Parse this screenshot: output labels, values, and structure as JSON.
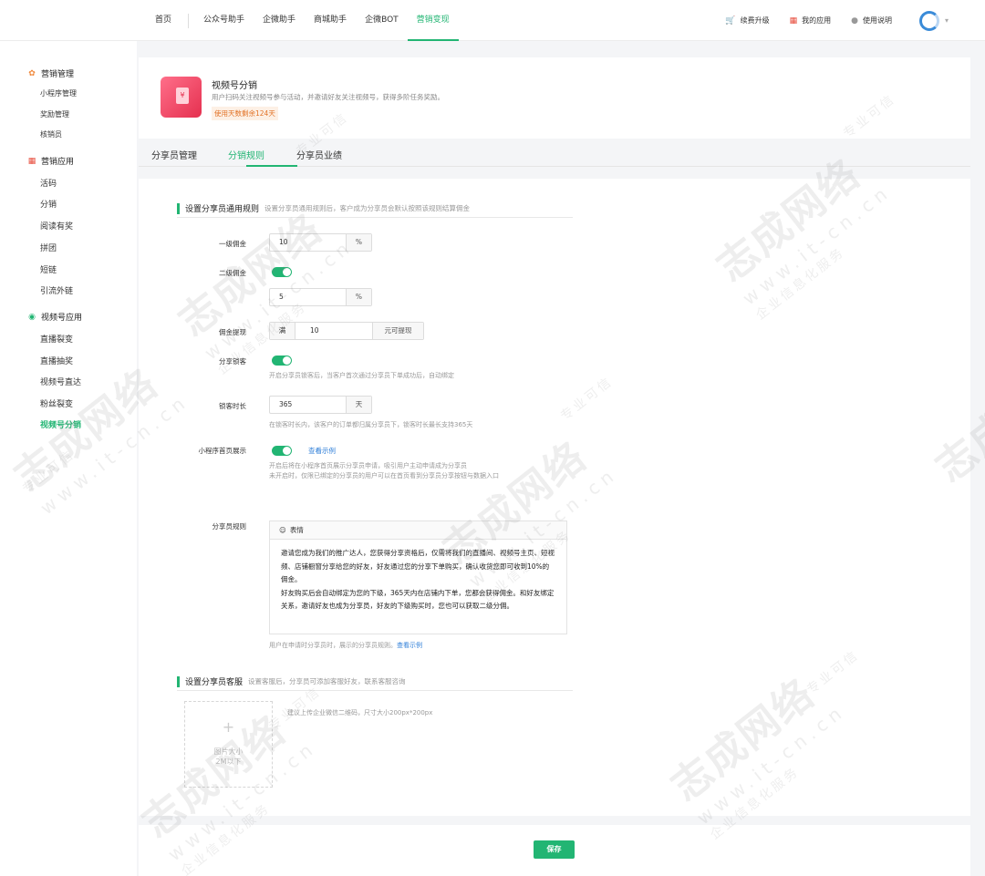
{
  "topnav": {
    "items": [
      "首页",
      "公众号助手",
      "企微助手",
      "商城助手",
      "企微BOT",
      "营销变现"
    ],
    "active_index": 5,
    "right": {
      "renew": "续费升级",
      "my_apps": "我的应用",
      "help": "使用说明"
    }
  },
  "sidebar": {
    "groups": [
      {
        "label": "营销管理",
        "icon": "gear-icon",
        "items": [
          "小程序管理",
          "奖励管理",
          "核销员"
        ]
      },
      {
        "label": "营销应用",
        "icon": "apps-grid-icon",
        "items": [
          "活码",
          "分销",
          "阅读有奖",
          "拼团",
          "短链",
          "引流外链"
        ]
      },
      {
        "label": "视频号应用",
        "icon": "video-channel-icon",
        "items": [
          "直播裂变",
          "直播抽奖",
          "视频号直达",
          "粉丝裂变",
          "视频号分销"
        ]
      }
    ],
    "active_item": "视频号分销"
  },
  "app": {
    "title": "视频号分销",
    "desc": "用户扫码关注视频号参与活动，并邀请好友关注视频号，获得多阶任务奖励。",
    "badge": "使用天数剩余124天"
  },
  "tabs": [
    "分享员管理",
    "分销规则",
    "分享员业绩"
  ],
  "active_tab": 1,
  "rules": {
    "section_title": "设置分享员通用规则",
    "section_hint": "设置分享员通用规则后，客户成为分享员会默认按照该规则结算佣金",
    "level1": {
      "label": "一级佣金",
      "value": "10",
      "suffix": "%"
    },
    "level2": {
      "label": "二级佣金",
      "enabled": true,
      "value": "5",
      "suffix": "%"
    },
    "withdraw": {
      "label": "佣金提现",
      "prefix": "满",
      "value": "10",
      "suffix": "元可提现"
    },
    "lock": {
      "label": "分享锁客",
      "enabled": true,
      "help": "开启分享员锁客后，当客户首次通过分享员下单成功后，自动绑定"
    },
    "lock_duration": {
      "label": "锁客时长",
      "value": "365",
      "suffix": "天",
      "help": "在锁客时长内，该客户的订单都归属分享员下，锁客时长最长支持365天"
    },
    "homepage": {
      "label": "小程序首页展示",
      "enabled": true,
      "link": "查看示例",
      "help1": "开启后将在小程序首页展示分享员申请，吸引用户主动申请成为分享员",
      "help2": "未开启时，仅限已绑定的分享员的用户可以在首页看到分享员分享按钮与数据入口"
    },
    "rule_text": {
      "label": "分享员规则",
      "toolbar": "表情",
      "p1": "邀请您成为我们的推广达人，您获得分享资格后，仅需将我们的直播间、视频号主页、短视频、店铺橱窗分享给您的好友，好友通过您的分享下单购买，确认收货您即可收到10%的佣金。",
      "p2": "好友购买后会自动绑定为您的下级，365天内在店铺内下单，您都会获得佣金。和好友绑定关系，邀请好友也成为分享员，好友的下级购买时，您也可以获取二级分佣。",
      "help": "用户在申请时分享员时，展示的分享员规则。",
      "help_link": "查看示例"
    }
  },
  "service": {
    "section_title": "设置分享员客服",
    "section_hint": "设置客服后，分享员可添加客服好友，联系客服咨询",
    "upload_plus": "+",
    "upload_hint1": "图片大小",
    "upload_hint2": "2M以下",
    "tip": "建议上传企业微信二维码，尺寸大小200px*200px"
  },
  "save_label": "保存",
  "watermark": {
    "brand": "志成网络",
    "url": "www.it-cn.cn",
    "slogan": "企业信息化服务",
    "tag": "专业可信"
  },
  "colors": {
    "accent": "#22b573",
    "link": "#2f7fd8",
    "badge": "#e27328"
  }
}
